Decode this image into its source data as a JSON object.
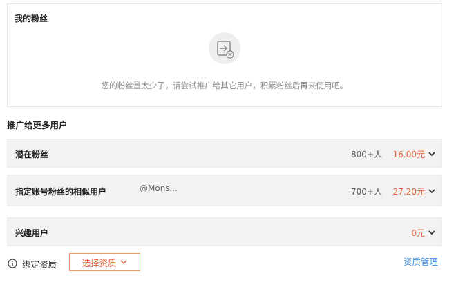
{
  "fans": {
    "title": "我的粉丝",
    "empty_message": "您的粉丝量太少了，请尝试推广给其它用户，积累粉丝后再来使用吧。",
    "empty_icon": "export-icon"
  },
  "promote": {
    "title": "推广给更多用户",
    "rows": [
      {
        "label": "潜在粉丝",
        "sub": "",
        "count": "800+人",
        "price": "16.00元"
      },
      {
        "label": "指定账号粉丝的相似用户",
        "sub": "@Mons...",
        "count": "700+人",
        "price": "27.20元"
      },
      {
        "label": "兴趣用户",
        "sub": "",
        "count": "",
        "price": "0元"
      }
    ]
  },
  "footer": {
    "bind_label": "绑定资质",
    "select_button": "选择资质",
    "manage_link": "资质管理"
  },
  "colors": {
    "accent": "#e8613a",
    "link": "#3a8ee6",
    "row_bg": "#f2f2f3"
  }
}
